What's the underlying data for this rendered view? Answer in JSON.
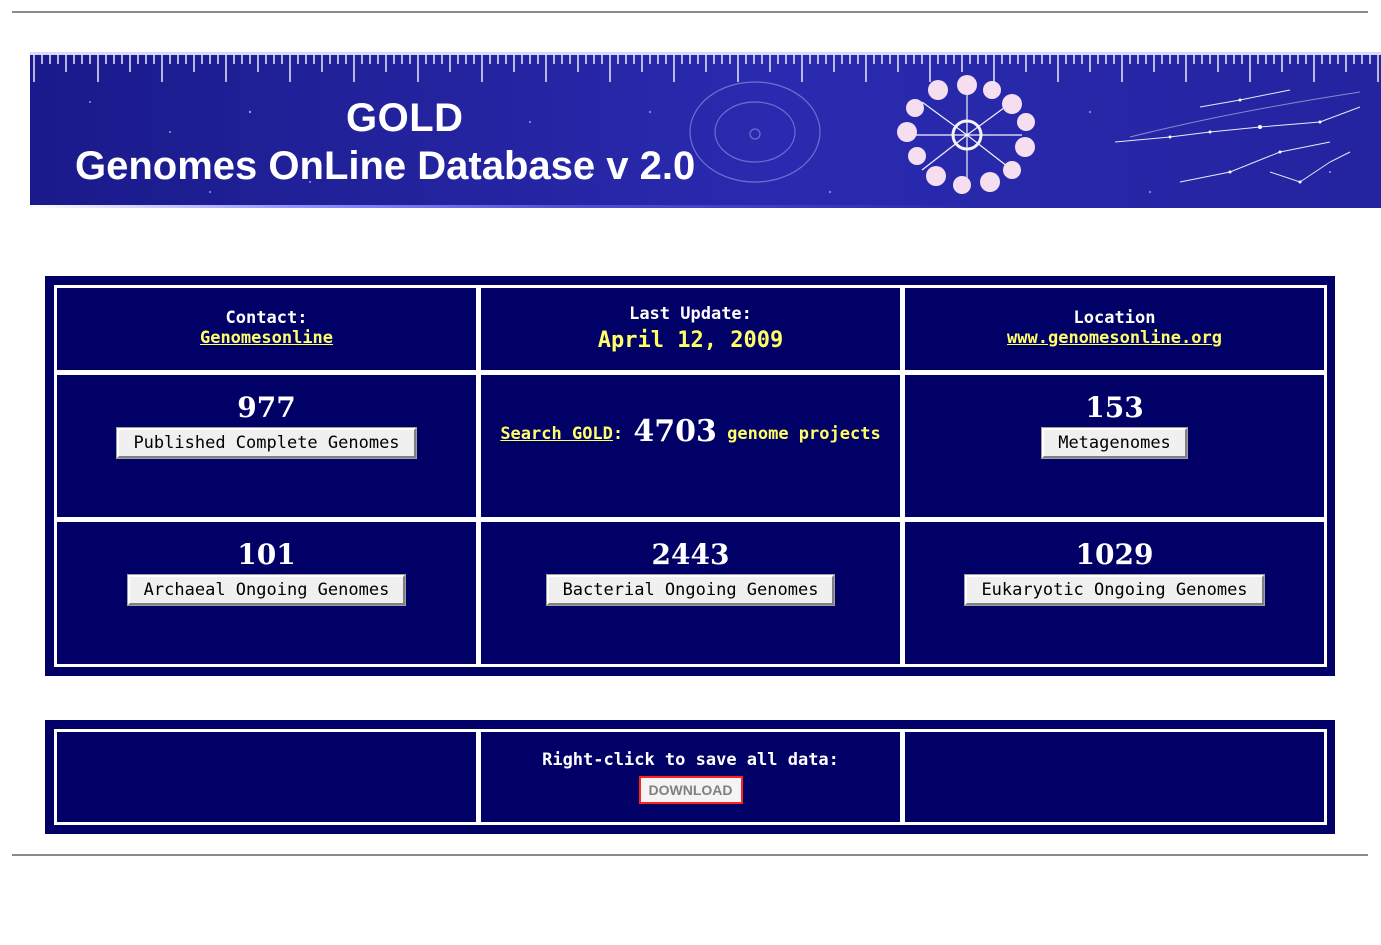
{
  "banner": {
    "title": "GOLD",
    "subtitle": "Genomes OnLine Database v 2.0"
  },
  "info_row": {
    "contact_label": "Contact:",
    "contact_link": "Genomesonline",
    "update_label": "Last Update:",
    "update_date": "April 12, 2009",
    "location_label": "Location",
    "location_link": "www.genomesonline.org"
  },
  "stats": {
    "published": {
      "count": "977",
      "button": "Published Complete Genomes"
    },
    "search": {
      "link": "Search GOLD",
      "sep": ":",
      "count": "4703",
      "suffix": "genome projects"
    },
    "metagenomes": {
      "count": "153",
      "button": "Metagenomes"
    },
    "archaeal": {
      "count": "101",
      "button": "Archaeal Ongoing Genomes"
    },
    "bacterial": {
      "count": "2443",
      "button": "Bacterial Ongoing Genomes"
    },
    "eukaryotic": {
      "count": "1029",
      "button": "Eukaryotic Ongoing Genomes"
    }
  },
  "download": {
    "label": "Right-click to save all data:",
    "button": "DOWNLOAD"
  },
  "colors": {
    "panel_bg": "#000066",
    "link_yellow": "#ffff66",
    "download_border": "#ff2020"
  }
}
